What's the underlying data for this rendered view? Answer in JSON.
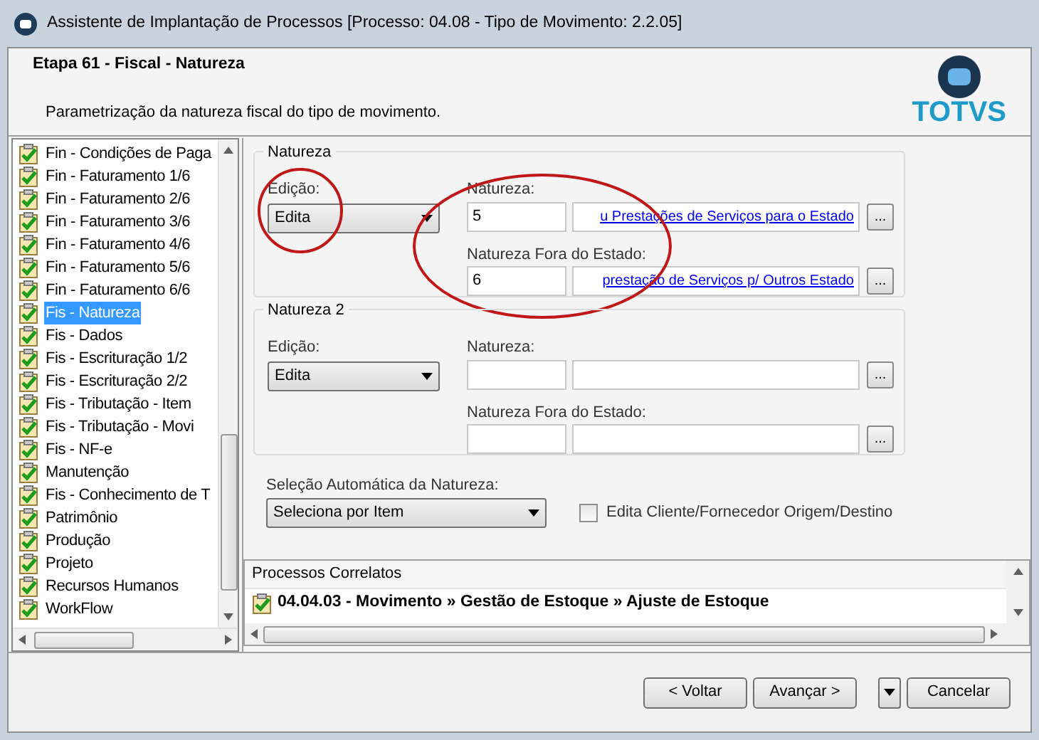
{
  "window": {
    "title": "Assistente de Implantação de Processos [Processo: 04.08 - Tipo de Movimento: 2.2.05]"
  },
  "header": {
    "step": "Etapa 61 - Fiscal - Natureza",
    "description": "Parametrização da natureza fiscal do tipo de movimento.",
    "logo": "TOTVS"
  },
  "steps": [
    {
      "label": "Fin - Condições de Paga",
      "selected": false
    },
    {
      "label": "Fin - Faturamento 1/6",
      "selected": false
    },
    {
      "label": "Fin - Faturamento 2/6",
      "selected": false
    },
    {
      "label": "Fin - Faturamento 3/6",
      "selected": false
    },
    {
      "label": "Fin - Faturamento 4/6",
      "selected": false
    },
    {
      "label": "Fin - Faturamento 5/6",
      "selected": false
    },
    {
      "label": "Fin - Faturamento 6/6",
      "selected": false
    },
    {
      "label": "Fis - Natureza",
      "selected": true
    },
    {
      "label": "Fis - Dados",
      "selected": false
    },
    {
      "label": "Fis - Escrituração 1/2",
      "selected": false
    },
    {
      "label": "Fis - Escrituração 2/2",
      "selected": false
    },
    {
      "label": "Fis - Tributação - Item",
      "selected": false
    },
    {
      "label": "Fis - Tributação - Movi",
      "selected": false
    },
    {
      "label": "Fis - NF-e",
      "selected": false
    },
    {
      "label": "Manutenção",
      "selected": false
    },
    {
      "label": "Fis - Conhecimento de T",
      "selected": false
    },
    {
      "label": "Patrimônio",
      "selected": false
    },
    {
      "label": "Produção",
      "selected": false
    },
    {
      "label": "Projeto",
      "selected": false
    },
    {
      "label": "Recursos Humanos",
      "selected": false
    },
    {
      "label": "WorkFlow",
      "selected": false
    }
  ],
  "groups": [
    {
      "title": "Natureza",
      "edicao_label": "Edição:",
      "edicao_value": "Edita",
      "natureza_label": "Natureza:",
      "natureza_code": "5",
      "natureza_desc": "u Prestações de Serviços para o Estado",
      "fora_label": "Natureza Fora do Estado:",
      "fora_code": "6",
      "fora_desc": "prestação de Serviços p/ Outros Estado",
      "browse": "...",
      "highlighted": true
    },
    {
      "title": "Natureza 2",
      "edicao_label": "Edição:",
      "edicao_value": "Edita",
      "natureza_label": "Natureza:",
      "fora_label": "Natureza Fora do Estado:",
      "browse": "...",
      "highlighted": false
    }
  ],
  "auto_selection": {
    "label": "Seleção Automática da Natureza:",
    "value": "Seleciona por Item"
  },
  "edit_checkbox": {
    "label": "Edita Cliente/Fornecedor Origem/Destino",
    "checked": false
  },
  "related": {
    "title": "Processos Correlatos",
    "items": [
      "04.04.03 - Movimento » Gestão de Estoque » Ajuste de Estoque"
    ]
  },
  "buttons": [
    "< Voltar",
    "Avançar >",
    "Cancelar"
  ]
}
